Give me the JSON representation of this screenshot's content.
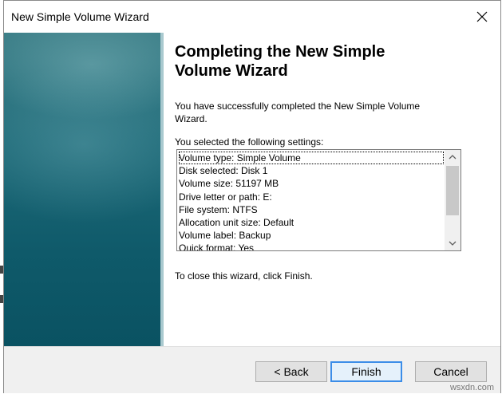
{
  "window": {
    "title": "New Simple Volume Wizard"
  },
  "content": {
    "heading_line1": "Completing the New Simple",
    "heading_line2": "Volume Wizard",
    "success_line1": "You have successfully completed the New Simple Volume",
    "success_line2": "Wizard.",
    "settings_label": "You selected the following settings:",
    "settings": [
      "Volume type: Simple Volume",
      "Disk selected: Disk 1",
      "Volume size: 51197 MB",
      "Drive letter or path: E:",
      "File system: NTFS",
      "Allocation unit size: Default",
      "Volume label: Backup",
      "Quick format: Yes"
    ],
    "close_instructions": "To close this wizard, click Finish."
  },
  "buttons": {
    "back": "< Back",
    "finish": "Finish",
    "cancel": "Cancel"
  },
  "watermark": "wsxdn.com",
  "colors": {
    "banner": "#1e6a78",
    "primary_button_border": "#3c8de8"
  },
  "scrollbar": {
    "thumb_fraction": 0.5
  }
}
